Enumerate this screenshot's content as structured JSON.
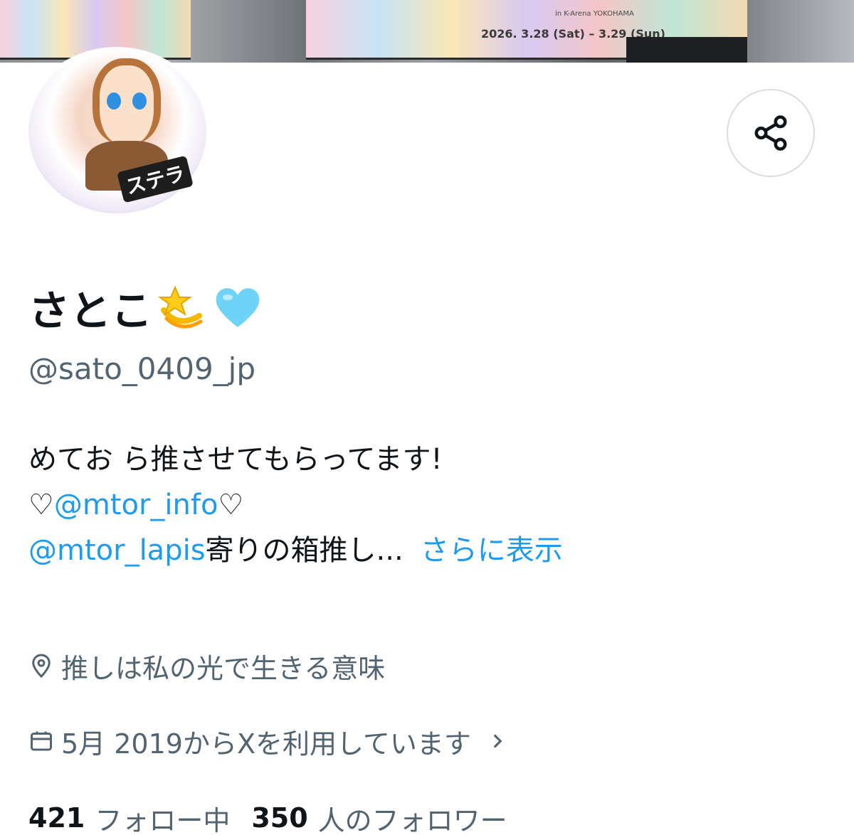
{
  "banner": {
    "poster_date": "2026. 3.28 (Sat) – 3.29 (Sun)",
    "poster_subtitle": "in K-Arena YOKOHAMA"
  },
  "avatar": {
    "badge_text": "ステラ"
  },
  "profile": {
    "display_name": "さとこ",
    "name_emojis": [
      "dizzy-star-emoji",
      "light-blue-heart-emoji"
    ],
    "handle": "@sato_0409_jp",
    "bio": {
      "line1": "めてお ら推させてもらってます!",
      "line2_prefix": "♡",
      "line2_mention": "@mtor_info",
      "line2_suffix": "♡",
      "line3_mention": "@mtor_lapis",
      "line3_text": "寄りの箱推し...",
      "show_more": "さらに表示"
    },
    "location": "推しは私の光で生きる意味",
    "joined": "5月 2019からXを利用しています",
    "following_count": "421",
    "following_label": "フォロー中",
    "followers_count": "350",
    "followers_label": "人のフォロワー"
  },
  "icons": {
    "share": "share-icon",
    "location": "location-pin-icon",
    "calendar": "calendar-icon",
    "chevron": "chevron-right-icon"
  },
  "colors": {
    "link": "#1d9bf0",
    "secondary_text": "#536471",
    "primary_text": "#0f1419"
  }
}
